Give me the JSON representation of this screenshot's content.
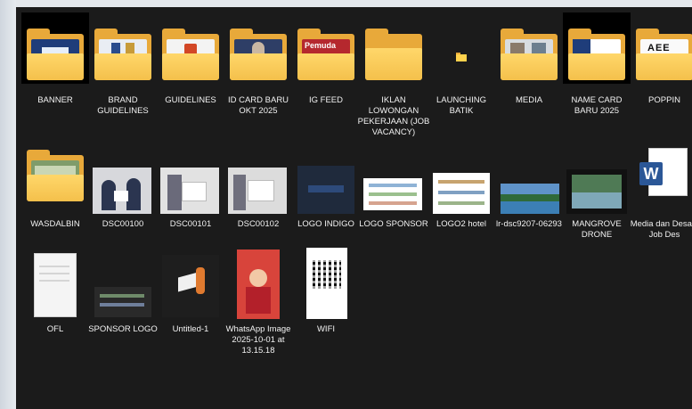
{
  "items": [
    {
      "label": "BANNER"
    },
    {
      "label": "BRAND GUIDELINES"
    },
    {
      "label": "GUIDELINES"
    },
    {
      "label": "ID CARD BARU OKT 2025"
    },
    {
      "label": "IG FEED"
    },
    {
      "label": "IKLAN LOWONGAN PEKERJAAN (JOB VACANCY)"
    },
    {
      "label": "LAUNCHING BATIK"
    },
    {
      "label": "MEDIA"
    },
    {
      "label": "NAME CARD BARU 2025"
    },
    {
      "label": "POPPIN"
    },
    {
      "label": "WASDALBIN"
    },
    {
      "label": "DSC00100"
    },
    {
      "label": "DSC00101"
    },
    {
      "label": "DSC00102"
    },
    {
      "label": "LOGO INDIGO"
    },
    {
      "label": "LOGO SPONSOR"
    },
    {
      "label": "LOGO2 hotel"
    },
    {
      "label": "lr-dsc9207-06293"
    },
    {
      "label": "MANGROVE DRONE"
    },
    {
      "label": "Media dan Desain Job Des"
    },
    {
      "label": "OFL"
    },
    {
      "label": "SPONSOR LOGO"
    },
    {
      "label": "Untitled-1"
    },
    {
      "label": "WhatsApp Image 2025-10-01 at 13.15.18"
    },
    {
      "label": "WIFI"
    }
  ],
  "thumb_text": {
    "pemuda": "Pemuda",
    "poppin": "AEE",
    "word_letter": "W"
  },
  "colors": {
    "pane": "#1b1b1b",
    "folder": "#e8a93a",
    "folder_front": "#ffd76a",
    "text": "#f2f2f2",
    "word_blue": "#2b5797"
  }
}
